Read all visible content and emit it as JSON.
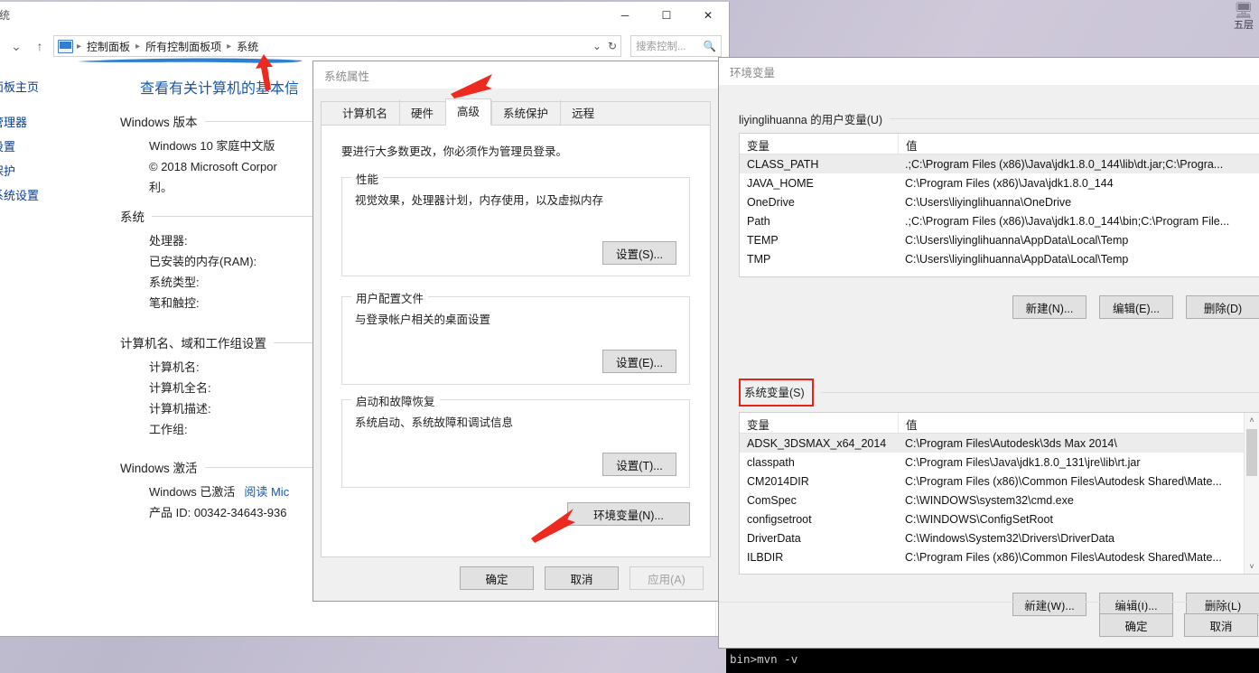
{
  "desktop": {
    "icon_label": "五层",
    "icon_glyph": "🖥"
  },
  "cmd": {
    "line": "bin>mvn -v"
  },
  "explorer": {
    "title": "统",
    "window_buttons": {
      "minimize": "─",
      "maximize": "☐",
      "close": "✕"
    },
    "nav": {
      "back": "←",
      "forward": "→",
      "recent": "⌄",
      "up": "↑",
      "refresh": "↻",
      "dropdown": "⌄"
    },
    "breadcrumbs": [
      "控制面板",
      "所有控制面板项",
      "系统"
    ],
    "search": {
      "placeholder": "搜索控制...",
      "icon": "search-icon"
    },
    "sidebar": {
      "items": [
        "控制面板主页",
        "设备管理器",
        "远程设置",
        "系统保护",
        "高级系统设置"
      ]
    },
    "main": {
      "heading": "查看有关计算机的基本信",
      "sections": [
        {
          "title": "Windows 版本",
          "rows": [
            {
              "key": "Windows 10 家庭中文版",
              "value": ""
            },
            {
              "key": "© 2018 Microsoft Corpor",
              "value": ""
            },
            {
              "key": "利。",
              "value": ""
            }
          ]
        },
        {
          "title": "系统",
          "rows": [
            {
              "key": "处理器:",
              "value": ""
            },
            {
              "key": "已安装的内存(RAM):",
              "value": ""
            },
            {
              "key": "系统类型:",
              "value": ""
            },
            {
              "key": "笔和触控:",
              "value": ""
            }
          ]
        },
        {
          "title": "计算机名、域和工作组设置",
          "rows": [
            {
              "key": "计算机名:",
              "value": ""
            },
            {
              "key": "计算机全名:",
              "value": ""
            },
            {
              "key": "计算机描述:",
              "value": ""
            },
            {
              "key": "工作组:",
              "value": ""
            }
          ]
        },
        {
          "title": "Windows 激活",
          "rows": [
            {
              "key": "Windows 已激活",
              "value": "阅读 Mic"
            },
            {
              "key": "产品 ID: 00342-34643-936",
              "value": ""
            }
          ]
        }
      ]
    }
  },
  "sysprops": {
    "title": "系统属性",
    "tabs": [
      {
        "label": "计算机名",
        "active": false
      },
      {
        "label": "硬件",
        "active": false
      },
      {
        "label": "高级",
        "active": true
      },
      {
        "label": "系统保护",
        "active": false
      },
      {
        "label": "远程",
        "active": false
      }
    ],
    "notice": "要进行大多数更改，你必须作为管理员登录。",
    "groups": [
      {
        "legend": "性能",
        "text": "视觉效果，处理器计划，内存使用，以及虚拟内存",
        "button": "设置(S)..."
      },
      {
        "legend": "用户配置文件",
        "text": "与登录帐户相关的桌面设置",
        "button": "设置(E)..."
      },
      {
        "legend": "启动和故障恢复",
        "text": "系统启动、系统故障和调试信息",
        "button": "设置(T)..."
      }
    ],
    "env_button": "环境变量(N)...",
    "footer": {
      "ok": "确定",
      "cancel": "取消",
      "apply": "应用(A)"
    }
  },
  "envvars": {
    "title": "环境变量",
    "user_section_label": "liyinglihuanna 的用户变量(U)",
    "system_section_label": "系统变量(S)",
    "columns": [
      "变量",
      "值"
    ],
    "user_rows": [
      {
        "name": "CLASS_PATH",
        "value": ".;C:\\Program Files (x86)\\Java\\jdk1.8.0_144\\lib\\dt.jar;C:\\Progra...",
        "selected": true
      },
      {
        "name": "JAVA_HOME",
        "value": "C:\\Program Files (x86)\\Java\\jdk1.8.0_144",
        "selected": false
      },
      {
        "name": "OneDrive",
        "value": "C:\\Users\\liyinglihuanna\\OneDrive",
        "selected": false
      },
      {
        "name": "Path",
        "value": ".;C:\\Program Files (x86)\\Java\\jdk1.8.0_144\\bin;C:\\Program File...",
        "selected": false
      },
      {
        "name": "TEMP",
        "value": "C:\\Users\\liyinglihuanna\\AppData\\Local\\Temp",
        "selected": false
      },
      {
        "name": "TMP",
        "value": "C:\\Users\\liyinglihuanna\\AppData\\Local\\Temp",
        "selected": false
      }
    ],
    "user_buttons": {
      "new": "新建(N)...",
      "edit": "编辑(E)...",
      "delete": "删除(D)"
    },
    "system_rows": [
      {
        "name": "ADSK_3DSMAX_x64_2014",
        "value": "C:\\Program Files\\Autodesk\\3ds Max 2014\\",
        "selected": true
      },
      {
        "name": "classpath",
        "value": "C:\\Program Files\\Java\\jdk1.8.0_131\\jre\\lib\\rt.jar",
        "selected": false
      },
      {
        "name": "CM2014DIR",
        "value": "C:\\Program Files (x86)\\Common Files\\Autodesk Shared\\Mate...",
        "selected": false
      },
      {
        "name": "ComSpec",
        "value": "C:\\WINDOWS\\system32\\cmd.exe",
        "selected": false
      },
      {
        "name": "configsetroot",
        "value": "C:\\WINDOWS\\ConfigSetRoot",
        "selected": false
      },
      {
        "name": "DriverData",
        "value": "C:\\Windows\\System32\\Drivers\\DriverData",
        "selected": false
      },
      {
        "name": "ILBDIR",
        "value": "C:\\Program Files (x86)\\Common Files\\Autodesk Shared\\Mate...",
        "selected": false
      }
    ],
    "system_buttons": {
      "new": "新建(W)...",
      "edit": "编辑(I)...",
      "delete": "删除(L)"
    },
    "footer": {
      "ok": "确定",
      "cancel": "取消"
    },
    "scroll": {
      "up": "˄",
      "down": "˅"
    }
  },
  "annotations": {
    "underline_color": "#2e7fd1",
    "arrow_color": "#ee2a20"
  }
}
